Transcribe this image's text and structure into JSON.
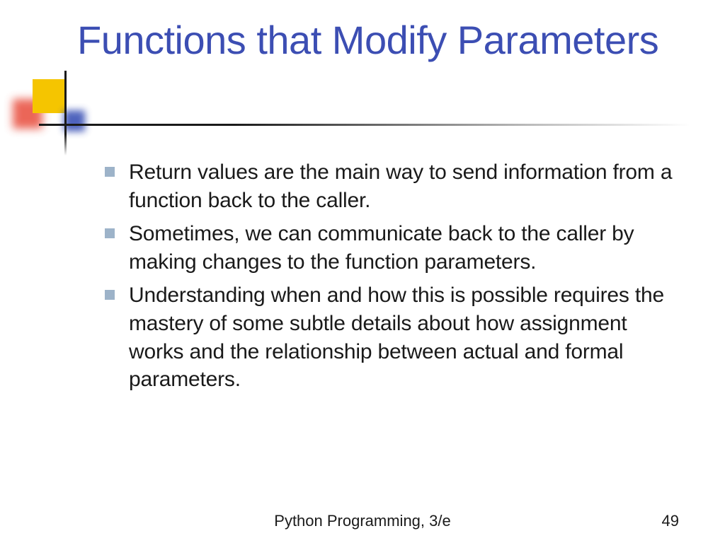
{
  "title": "Functions that Modify Parameters",
  "bullets": [
    "Return values are the main way to send information from a function back to the caller.",
    "Sometimes, we can communicate back to the caller by  making changes to the function parameters.",
    "Understanding when and how this is possible requires the mastery of some subtle details about how assignment works and the relationship between actual and formal parameters."
  ],
  "footer": "Python Programming, 3/e",
  "pageNumber": "49"
}
